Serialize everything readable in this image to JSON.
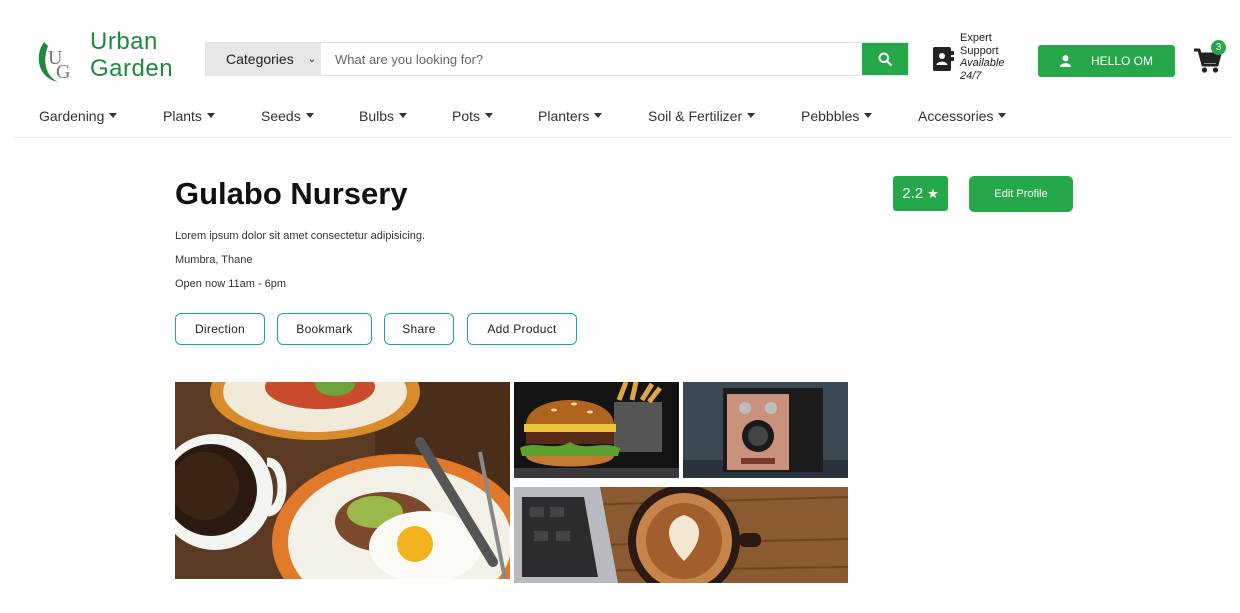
{
  "header": {
    "logo": {
      "line1": "Urban",
      "line2": "Garden"
    },
    "search": {
      "category_label": "Categories",
      "placeholder": "What are you looking for?"
    },
    "support": {
      "line1": "Expert",
      "line2": "Support",
      "line3": "Available",
      "line4": "24/7"
    },
    "user_button": "HELLO OM",
    "cart_count": "3"
  },
  "nav": {
    "items": [
      "Gardening",
      "Plants",
      "Seeds",
      "Bulbs",
      "Pots",
      "Planters",
      "Soil & Fertilizer",
      "Pebbbles",
      "Accessories"
    ]
  },
  "store": {
    "name": "Gulabo Nursery",
    "description": "Lorem ipsum dolor sit amet consectetur adipisicing.",
    "location": "Mumbra, Thane",
    "hours": "Open now 11am - 6pm",
    "rating": "2.2",
    "edit_label": "Edit Profile",
    "actions": [
      "Direction",
      "Bookmark",
      "Share",
      "Add Product"
    ]
  },
  "colors": {
    "accent": "#25a84a",
    "outline": "#17a2b8",
    "logo_green": "#1e8a3c"
  },
  "icons": [
    "search-icon",
    "contact-support-icon",
    "user-icon",
    "cart-icon",
    "star-icon",
    "caret-down-icon"
  ]
}
